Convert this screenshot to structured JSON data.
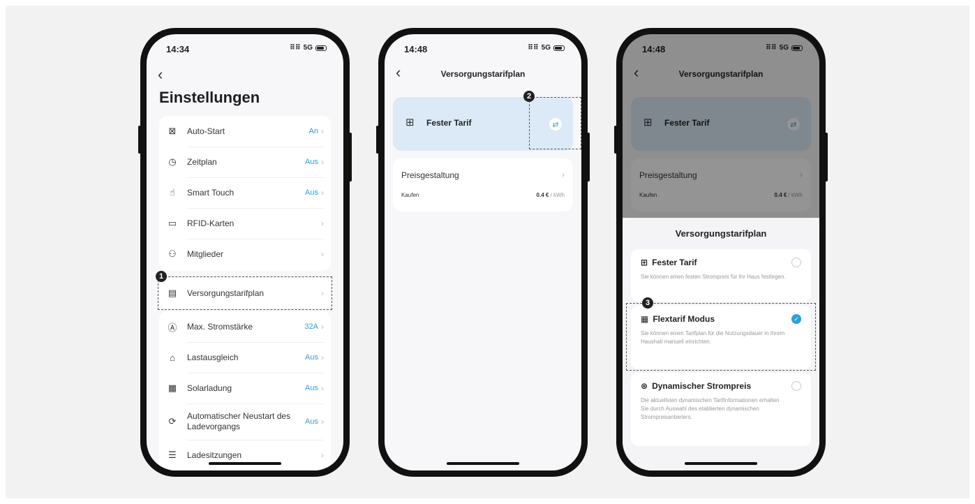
{
  "phone1": {
    "time": "14:34",
    "signal": "5G",
    "title": "Einstellungen",
    "items": [
      {
        "label": "Auto-Start",
        "value": "An",
        "icon": "auto-start-icon"
      },
      {
        "label": "Zeitplan",
        "value": "Aus",
        "icon": "clock-icon"
      },
      {
        "label": "Smart Touch",
        "value": "Aus",
        "icon": "touch-icon"
      },
      {
        "label": "RFID-Karten",
        "value": "",
        "icon": "card-icon"
      },
      {
        "label": "Mitglieder",
        "value": "",
        "icon": "members-icon"
      },
      {
        "label": "Versorgungstarifplan",
        "value": "",
        "icon": "tariff-icon"
      },
      {
        "label": "Max. Stromstärke",
        "value": "32A",
        "icon": "ampere-icon"
      },
      {
        "label": "Lastausgleich",
        "value": "Aus",
        "icon": "house-icon"
      },
      {
        "label": "Solarladung",
        "value": "Aus",
        "icon": "solar-icon"
      },
      {
        "label": "Automatischer Neustart des Ladevorgangs",
        "value": "Aus",
        "icon": "restart-icon"
      },
      {
        "label": "Ladesitzungen",
        "value": "",
        "icon": "list-icon"
      }
    ],
    "badge": "1"
  },
  "phone2": {
    "time": "14:48",
    "signal": "5G",
    "title": "Versorgungstarifplan",
    "tariff_name": "Fester Tarif",
    "pricing_label": "Preisgestaltung",
    "buy_label": "Kaufen",
    "price_value": "0.4 €",
    "price_unit": " / kWh",
    "badge": "2"
  },
  "phone3": {
    "time": "14:48",
    "signal": "5G",
    "title": "Versorgungstarifplan",
    "tariff_name": "Fester Tarif",
    "pricing_label": "Preisgestaltung",
    "buy_label": "Kaufen",
    "price_value": "0.4 €",
    "price_unit": " / kWh",
    "sheet_title": "Versorgungstarifplan",
    "options": [
      {
        "name": "Fester Tarif",
        "desc": "Sie können einen festen Strompreis für Ihr Haus festlegen.",
        "selected": false
      },
      {
        "name": "Flextarif Modus",
        "desc": "Sie können einen Tarifplan für die Nutzungsdauer in Ihrem Haushalt manuell einrichten.",
        "selected": true
      },
      {
        "name": "Dynamischer Strompreis",
        "desc": "Die aktuellsten dynamischen Tarifinformationen erhalten Sie durch Auswahl des etablierten dynamischen Strompreisanbieters.",
        "selected": false
      }
    ],
    "badge": "3"
  },
  "colors": {
    "accent": "#2aa0d8",
    "tariff_card": "#dbeaf6",
    "frame": "#111111"
  }
}
